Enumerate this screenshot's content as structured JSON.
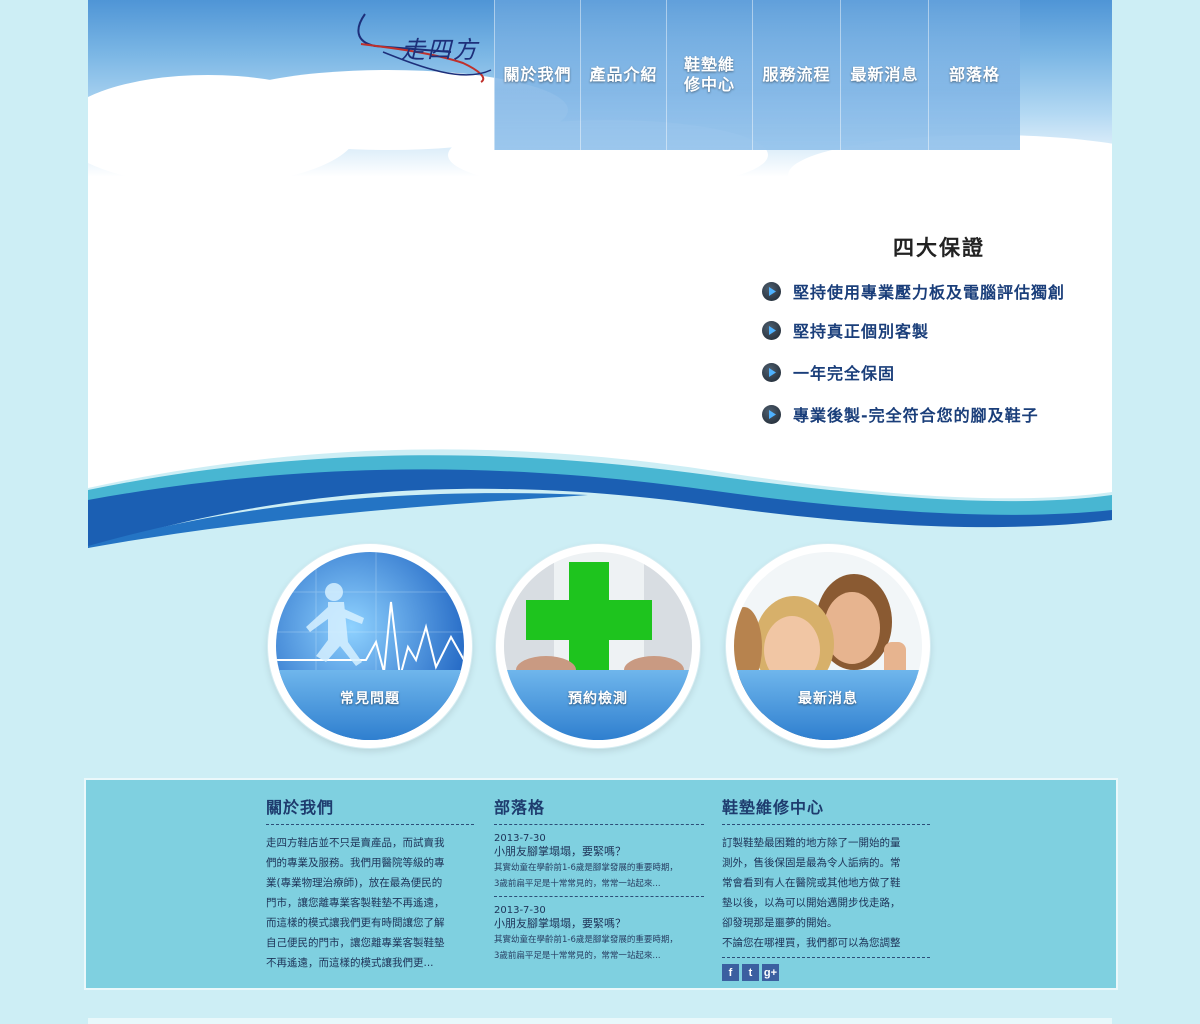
{
  "brand": {
    "logo_text": "走四方"
  },
  "nav": {
    "tabs": [
      {
        "label": "關於我們"
      },
      {
        "label": "產品介紹"
      },
      {
        "label": "鞋墊維\n修中心"
      },
      {
        "label": "服務流程"
      },
      {
        "label": "最新消息"
      },
      {
        "label": "部落格"
      }
    ]
  },
  "guarantee": {
    "title": "四大保證",
    "items": [
      "堅持使用專業壓力板及電腦評估獨創",
      "堅持真正個別客製",
      "一年完全保固",
      "專業後製-完全符合您的腳及鞋子"
    ]
  },
  "features": [
    {
      "label": "常見問題"
    },
    {
      "label": "預約檢測"
    },
    {
      "label": "最新消息"
    }
  ],
  "footer": {
    "about": {
      "title": "關於我們",
      "lines": [
        "走四方鞋店並不只是賣產品，而試賣我",
        "們的專業及服務。我們用醫院等級的專",
        "業(專業物理治療師)，放在最為便民的",
        "門市，讓您離專業客製鞋墊不再遙遠，",
        "而這樣的模式讓我們更有時間讓您了解",
        "自己便民的門市，讓您離專業客製鞋墊",
        "不再遙遠，而這樣的模式讓我們更..."
      ]
    },
    "blog": {
      "title": "部落格",
      "posts": [
        {
          "date": "2013-7-30",
          "title": "小朋友腳掌塌塌，要緊嗎？",
          "excerpt1": "其實幼童在學齡前1-6歲是腳掌發展的重要時期，",
          "excerpt2": "3歲前扁平足是十常常見的，常常一站起來..."
        },
        {
          "date": "2013-7-30",
          "title": "小朋友腳掌塌塌，要緊嗎？",
          "excerpt1": "其實幼童在學齡前1-6歲是腳掌發展的重要時期，",
          "excerpt2": "3歲前扁平足是十常常見的，常常一站起來..."
        }
      ]
    },
    "repair": {
      "title": "鞋墊維修中心",
      "lines": [
        "訂製鞋墊最困難的地方除了一開始的量",
        "測外，售後保固是最為令人詬病的。常",
        "常會看到有人在醫院或其他地方做了鞋",
        "墊以後，以為可以開始邁開步伐走路，",
        "卻發現那是噩夢的開始。",
        "不論您在哪裡買，我們都可以為您調整"
      ],
      "social": [
        "f",
        "t",
        "g+"
      ]
    }
  },
  "colors": {
    "accent": "#2f7fcf",
    "panel": "#7fd0e0",
    "background": "#cdeef5",
    "heading": "#1e3c6e"
  }
}
